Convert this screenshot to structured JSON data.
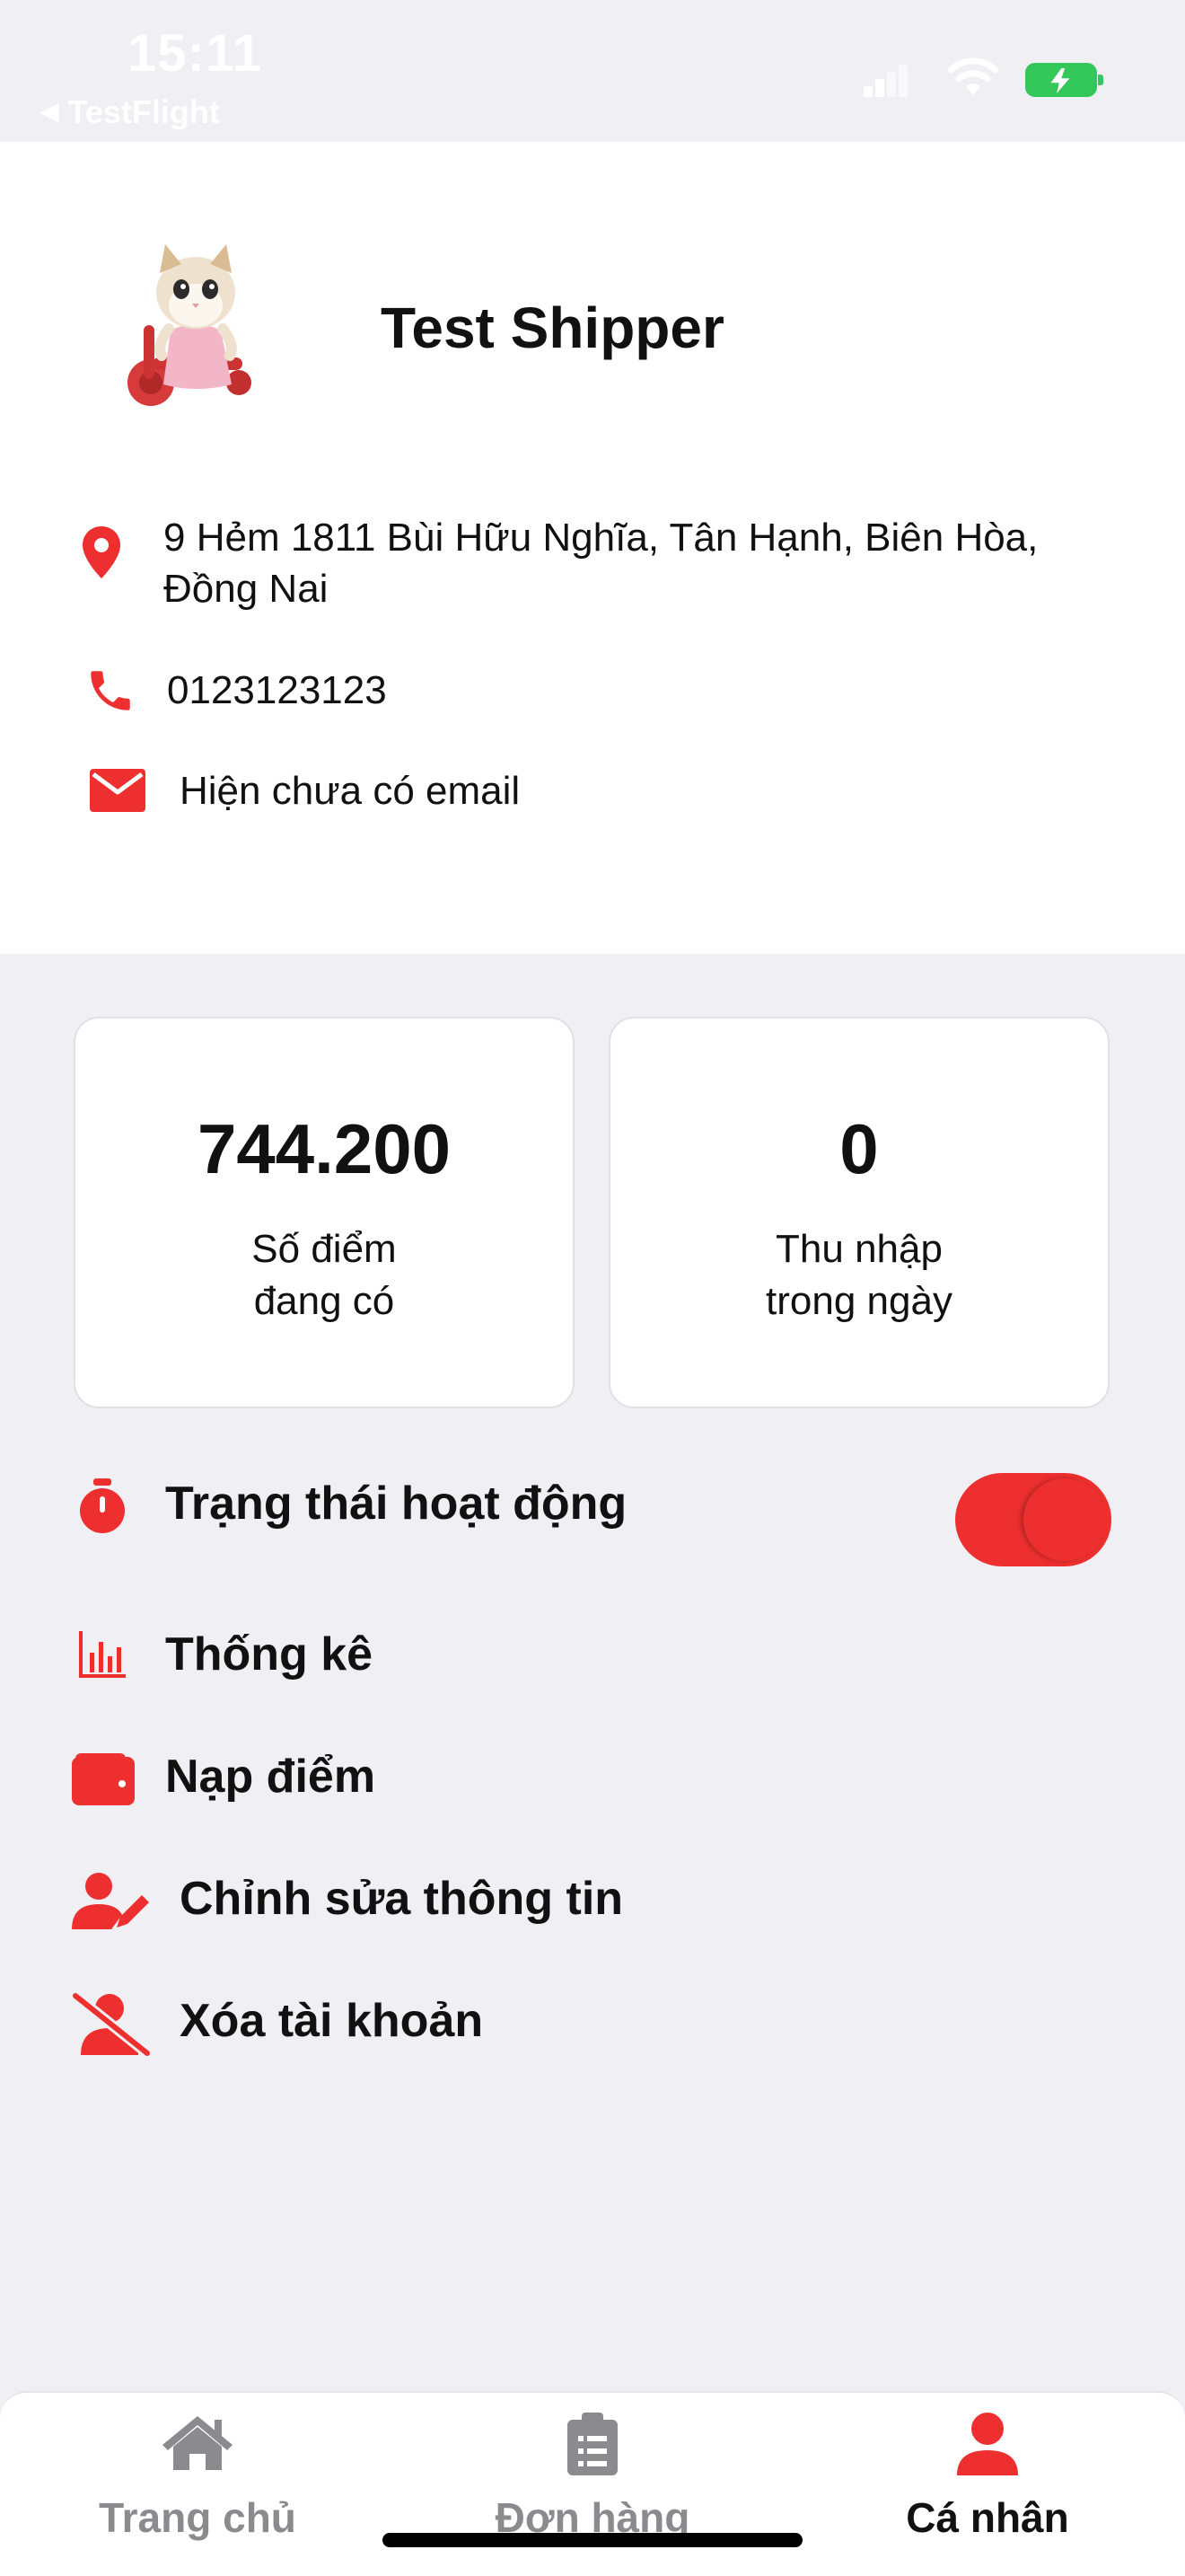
{
  "status_bar": {
    "time": "15:11",
    "back_app": "TestFlight"
  },
  "profile": {
    "name": "Test Shipper",
    "address": "9 Hẻm 1811 Bùi Hữu Nghĩa, Tân Hạnh, Biên Hòa, Đồng Nai",
    "phone": "0123123123",
    "email": "Hiện chưa có email"
  },
  "stats": [
    {
      "value": "744.200",
      "label_line1": "Số điểm",
      "label_line2": "đang có"
    },
    {
      "value": "0",
      "label_line1": "Thu nhập",
      "label_line2": "trong ngày"
    }
  ],
  "menu": {
    "status": {
      "label": "Trạng thái hoạt động",
      "toggle_on": true
    },
    "statistics": "Thống kê",
    "topup": "Nạp điểm",
    "edit_info": "Chỉnh sửa thông tin",
    "delete_account": "Xóa tài khoản"
  },
  "tabs": [
    {
      "label": "Trang chủ",
      "icon": "home-icon",
      "active": false
    },
    {
      "label": "Đơn hàng",
      "icon": "clipboard-icon",
      "active": false
    },
    {
      "label": "Cá nhân",
      "icon": "person-icon",
      "active": true
    }
  ],
  "colors": {
    "accent": "#ee2f2f",
    "inactive_tab": "#8a8a8f",
    "background": "#efeff4",
    "battery": "#34c759"
  }
}
